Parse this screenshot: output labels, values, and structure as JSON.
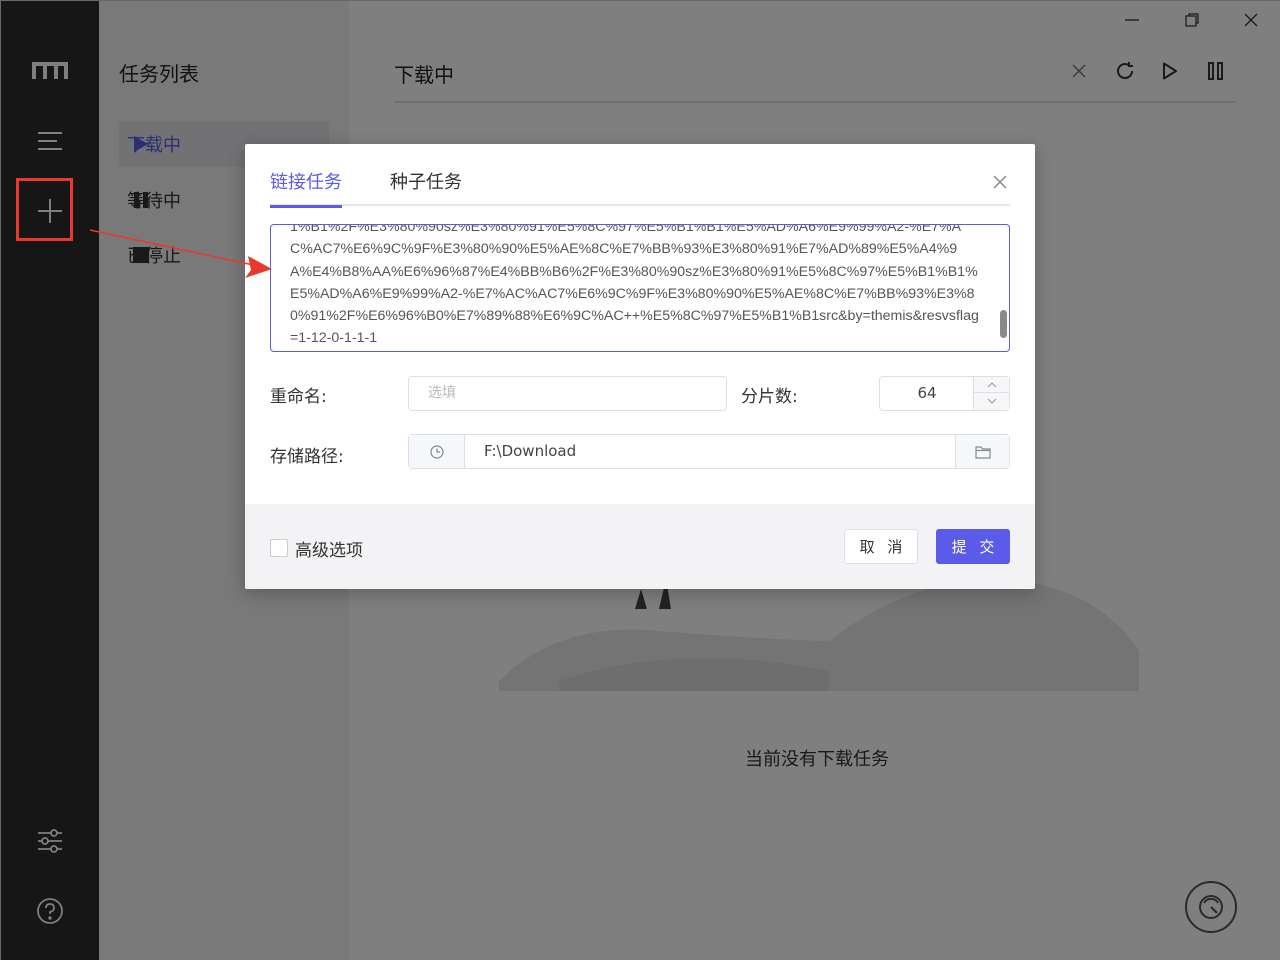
{
  "sidebar": {
    "logo_icon": "motrix-logo-icon",
    "icons": [
      "menu-icon",
      "add-icon",
      "settings-sliders-icon",
      "help-icon"
    ]
  },
  "tasklist": {
    "title": "任务列表",
    "items": [
      {
        "label": "下载中",
        "icon": "play-icon",
        "active": true
      },
      {
        "label": "等待中",
        "icon": "pause-icon",
        "active": false
      },
      {
        "label": "已停止",
        "icon": "stop-icon",
        "active": false
      }
    ]
  },
  "main": {
    "title": "下载中",
    "empty_text": "当前没有下载任务",
    "toolbar_icons": [
      "close-icon",
      "refresh-icon",
      "play-icon",
      "pause-icon"
    ]
  },
  "dialog": {
    "tabs": [
      {
        "label": "链接任务",
        "active": true
      },
      {
        "label": "种子任务",
        "active": false
      }
    ],
    "url_text": "1%B1%2F%E3%80%90sz%E3%80%91%E5%8C%97%E5%B1%B1%E5%AD%A6%E9%99%A2-%E7%AC%AC7%E6%9C%9F%E3%80%90%E5%AE%8C%E7%BB%93%E3%80%91%E7%AD%89%E5%A4%9A%E4%B8%AA%E6%96%87%E4%BB%B6%2F%E3%80%90sz%E3%80%91%E5%8C%97%E5%B1%B1%E5%AD%A6%E9%99%A2-%E7%AC%AC7%E6%9C%9F%E3%80%90%E5%AE%8C%E7%BB%93%E3%80%91%2F%E6%96%B0%E7%89%88%E6%9C%AC++%E5%8C%97%E5%B1%B1src&by=themis&resvsflag=1-12-0-1-1-1",
    "rename_label": "重命名:",
    "rename_placeholder": "选填",
    "split_label": "分片数:",
    "split_value": "64",
    "path_label": "存储路径:",
    "path_value": "F:\\Download",
    "advanced_label": "高级选项",
    "cancel_label": "取 消",
    "submit_label": "提 交"
  },
  "colors": {
    "accent": "#5b5bea",
    "sidebar_bg": "#2c2c2c",
    "annotation_red": "#e8382f"
  }
}
